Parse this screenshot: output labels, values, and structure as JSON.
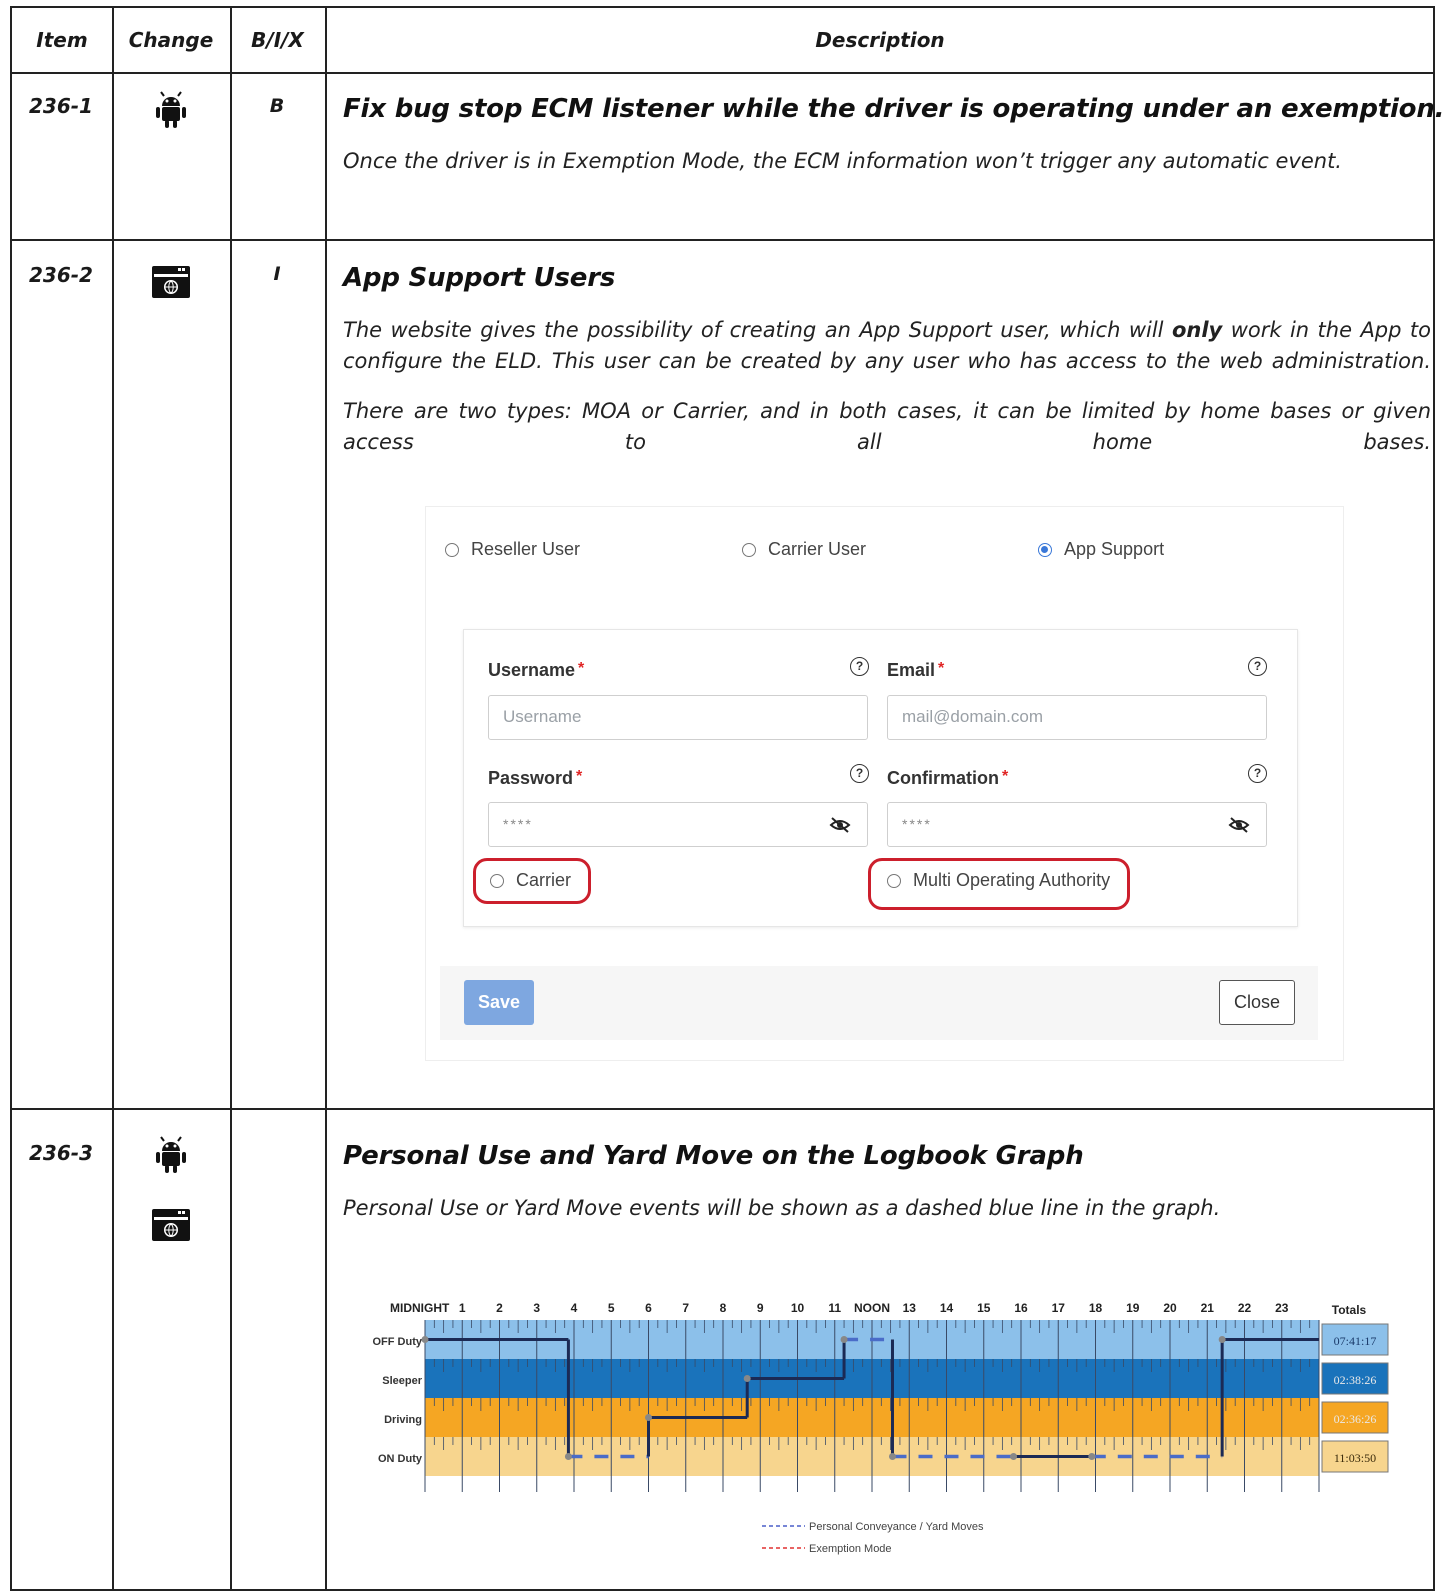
{
  "headers": {
    "item": "Item",
    "change": "Change",
    "bix": "B/I/X",
    "description": "Description"
  },
  "rows": [
    {
      "item": "236-1",
      "bix": "B",
      "title": "Fix bug stop ECM listener while the driver is operating under an exemption.",
      "text1": "Once the driver is in Exemption Mode, the ECM information won’t trigger any automatic event."
    },
    {
      "item": "236-2",
      "bix": "I",
      "title": "App Support Users",
      "text1_a": "The website gives the possibility of creating an App Support user, which will",
      "text1_bold": "only",
      "text1_b": "work in the App to configure the ELD. This user can be created by any user who has access to the web administration.",
      "text2": "There are two types:  MOA or Carrier, and in both cases, it can be limited by home bases or given access to all home bases."
    },
    {
      "item": "236-3",
      "bix": "",
      "title": "Personal Use and Yard Move on the Logbook Graph",
      "text1": "Personal Use or Yard Move events will be shown as a dashed blue line in the graph."
    }
  ],
  "icons": {
    "android": "android-icon",
    "web": "web-browser-icon"
  },
  "form": {
    "user_types": [
      "Reseller User",
      "Carrier User",
      "App Support"
    ],
    "selected_user_type": "App Support",
    "username_label": "Username",
    "username_placeholder": "Username",
    "email_label": "Email",
    "email_placeholder": "mail@domain.com",
    "password_label": "Password",
    "password_value": "****",
    "confirmation_label": "Confirmation",
    "confirmation_value": "****",
    "required_mark": "*",
    "help_mark": "?",
    "option_carrier": "Carrier",
    "option_moa": "Multi Operating Authority",
    "save_label": "Save",
    "close_label": "Close",
    "accent_color": "#3a78d8",
    "highlight_color": "#cc1f2c"
  },
  "chart_data": {
    "type": "line",
    "hour_labels": [
      "MIDNIGHT",
      "1",
      "2",
      "3",
      "4",
      "5",
      "6",
      "7",
      "8",
      "9",
      "10",
      "11",
      "NOON",
      "13",
      "14",
      "15",
      "16",
      "17",
      "18",
      "19",
      "20",
      "21",
      "22",
      "23"
    ],
    "rows": [
      "OFF Duty",
      "Sleeper",
      "Driving",
      "ON Duty"
    ],
    "row_colors": [
      "#8cc0ea",
      "#1a73bb",
      "#f5a623",
      "#f7d58e"
    ],
    "totals_label": "Totals",
    "totals": [
      "07:41:17",
      "02:38:26",
      "02:36:26",
      "11:03:50"
    ],
    "segments": [
      {
        "status": "OFF Duty",
        "start": 0.0,
        "end": 3.85,
        "style": "solid"
      },
      {
        "status": "ON Duty",
        "start": 3.85,
        "end": 6.0,
        "style": "dashed"
      },
      {
        "status": "Driving",
        "start": 6.0,
        "end": 8.65,
        "style": "solid"
      },
      {
        "status": "Sleeper",
        "start": 8.65,
        "end": 11.25,
        "style": "solid"
      },
      {
        "status": "OFF Duty",
        "start": 11.25,
        "end": 12.55,
        "style": "dashed"
      },
      {
        "status": "ON Duty",
        "start": 12.55,
        "end": 15.8,
        "style": "dashed"
      },
      {
        "status": "ON Duty",
        "start": 15.8,
        "end": 17.9,
        "style": "solid"
      },
      {
        "status": "ON Duty",
        "start": 17.9,
        "end": 21.4,
        "style": "dashed"
      },
      {
        "status": "OFF Duty",
        "start": 21.4,
        "end": 24.0,
        "style": "solid"
      }
    ],
    "legend": [
      {
        "label": "Personal Conveyance / Yard Moves",
        "color": "#4a5fc8"
      },
      {
        "label": "Exemption Mode",
        "color": "#e03030"
      }
    ],
    "line_color": "#1b2a55",
    "dash_color": "#4a6cc8"
  }
}
